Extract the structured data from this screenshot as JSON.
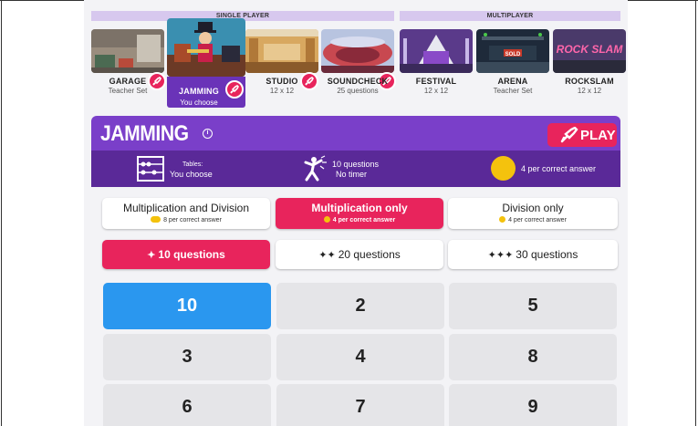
{
  "modes": {
    "single": "SINGLE PLAYER",
    "multi": "MULTIPLAYER"
  },
  "stages": [
    {
      "name": "GARAGE",
      "sub": "Teacher Set"
    },
    {
      "name": "JAMMING",
      "sub": "You choose"
    },
    {
      "name": "STUDIO",
      "sub": "12 x 12"
    },
    {
      "name": "SOUNDCHECK",
      "sub": "25 questions"
    },
    {
      "name": "FESTIVAL",
      "sub": "12 x 12"
    },
    {
      "name": "ARENA",
      "sub": "Teacher Set"
    },
    {
      "name": "ROCKSLAM",
      "sub": "12 x 12"
    }
  ],
  "rockslam_logo": "ROCK SLAM",
  "arena_sign": "SOLD",
  "panel": {
    "title": "JAMMING",
    "info_icon": "i",
    "play_label": "PLAY"
  },
  "info": {
    "tables_label": "Tables:",
    "tables_value": "You choose",
    "questions_value": "10 questions",
    "timer_value": "No timer",
    "reward": "4 per correct answer"
  },
  "operations": [
    {
      "label": "Multiplication and Division",
      "reward": "8 per correct answer",
      "selected": false
    },
    {
      "label": "Multiplication only",
      "reward": "4 per correct answer",
      "selected": true
    },
    {
      "label": "Division only",
      "reward": "4 per correct answer",
      "selected": false
    }
  ],
  "question_counts": [
    {
      "label": "10 questions",
      "selected": true
    },
    {
      "label": "20 questions",
      "selected": false
    },
    {
      "label": "30 questions",
      "selected": false
    }
  ],
  "tables": [
    {
      "value": "10",
      "selected": true
    },
    {
      "value": "2",
      "selected": false
    },
    {
      "value": "5",
      "selected": false
    },
    {
      "value": "3",
      "selected": false
    },
    {
      "value": "4",
      "selected": false
    },
    {
      "value": "8",
      "selected": false
    },
    {
      "value": "6",
      "selected": false
    },
    {
      "value": "7",
      "selected": false
    },
    {
      "value": "9",
      "selected": false
    }
  ],
  "colors": {
    "purple": "#7a3fc9",
    "dark_purple": "#5a2998",
    "pink": "#e8245c",
    "blue": "#2a97ef",
    "coin": "#f4c20d"
  }
}
